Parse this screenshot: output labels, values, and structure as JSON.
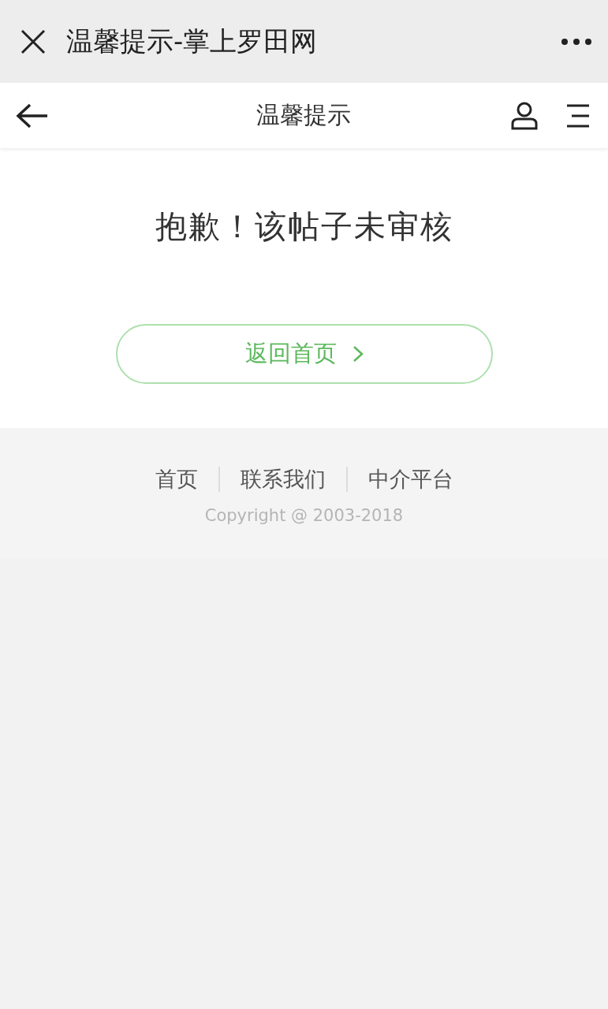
{
  "window": {
    "title": "温馨提示-掌上罗田网"
  },
  "header": {
    "title": "温馨提示"
  },
  "message": "抱歉！该帖子未审核",
  "home_button": {
    "label": "返回首页"
  },
  "footer": {
    "links": [
      {
        "label": "首页"
      },
      {
        "label": "联系我们"
      },
      {
        "label": "中介平台"
      }
    ],
    "copyright": "Copyright @ 2003-2018"
  }
}
